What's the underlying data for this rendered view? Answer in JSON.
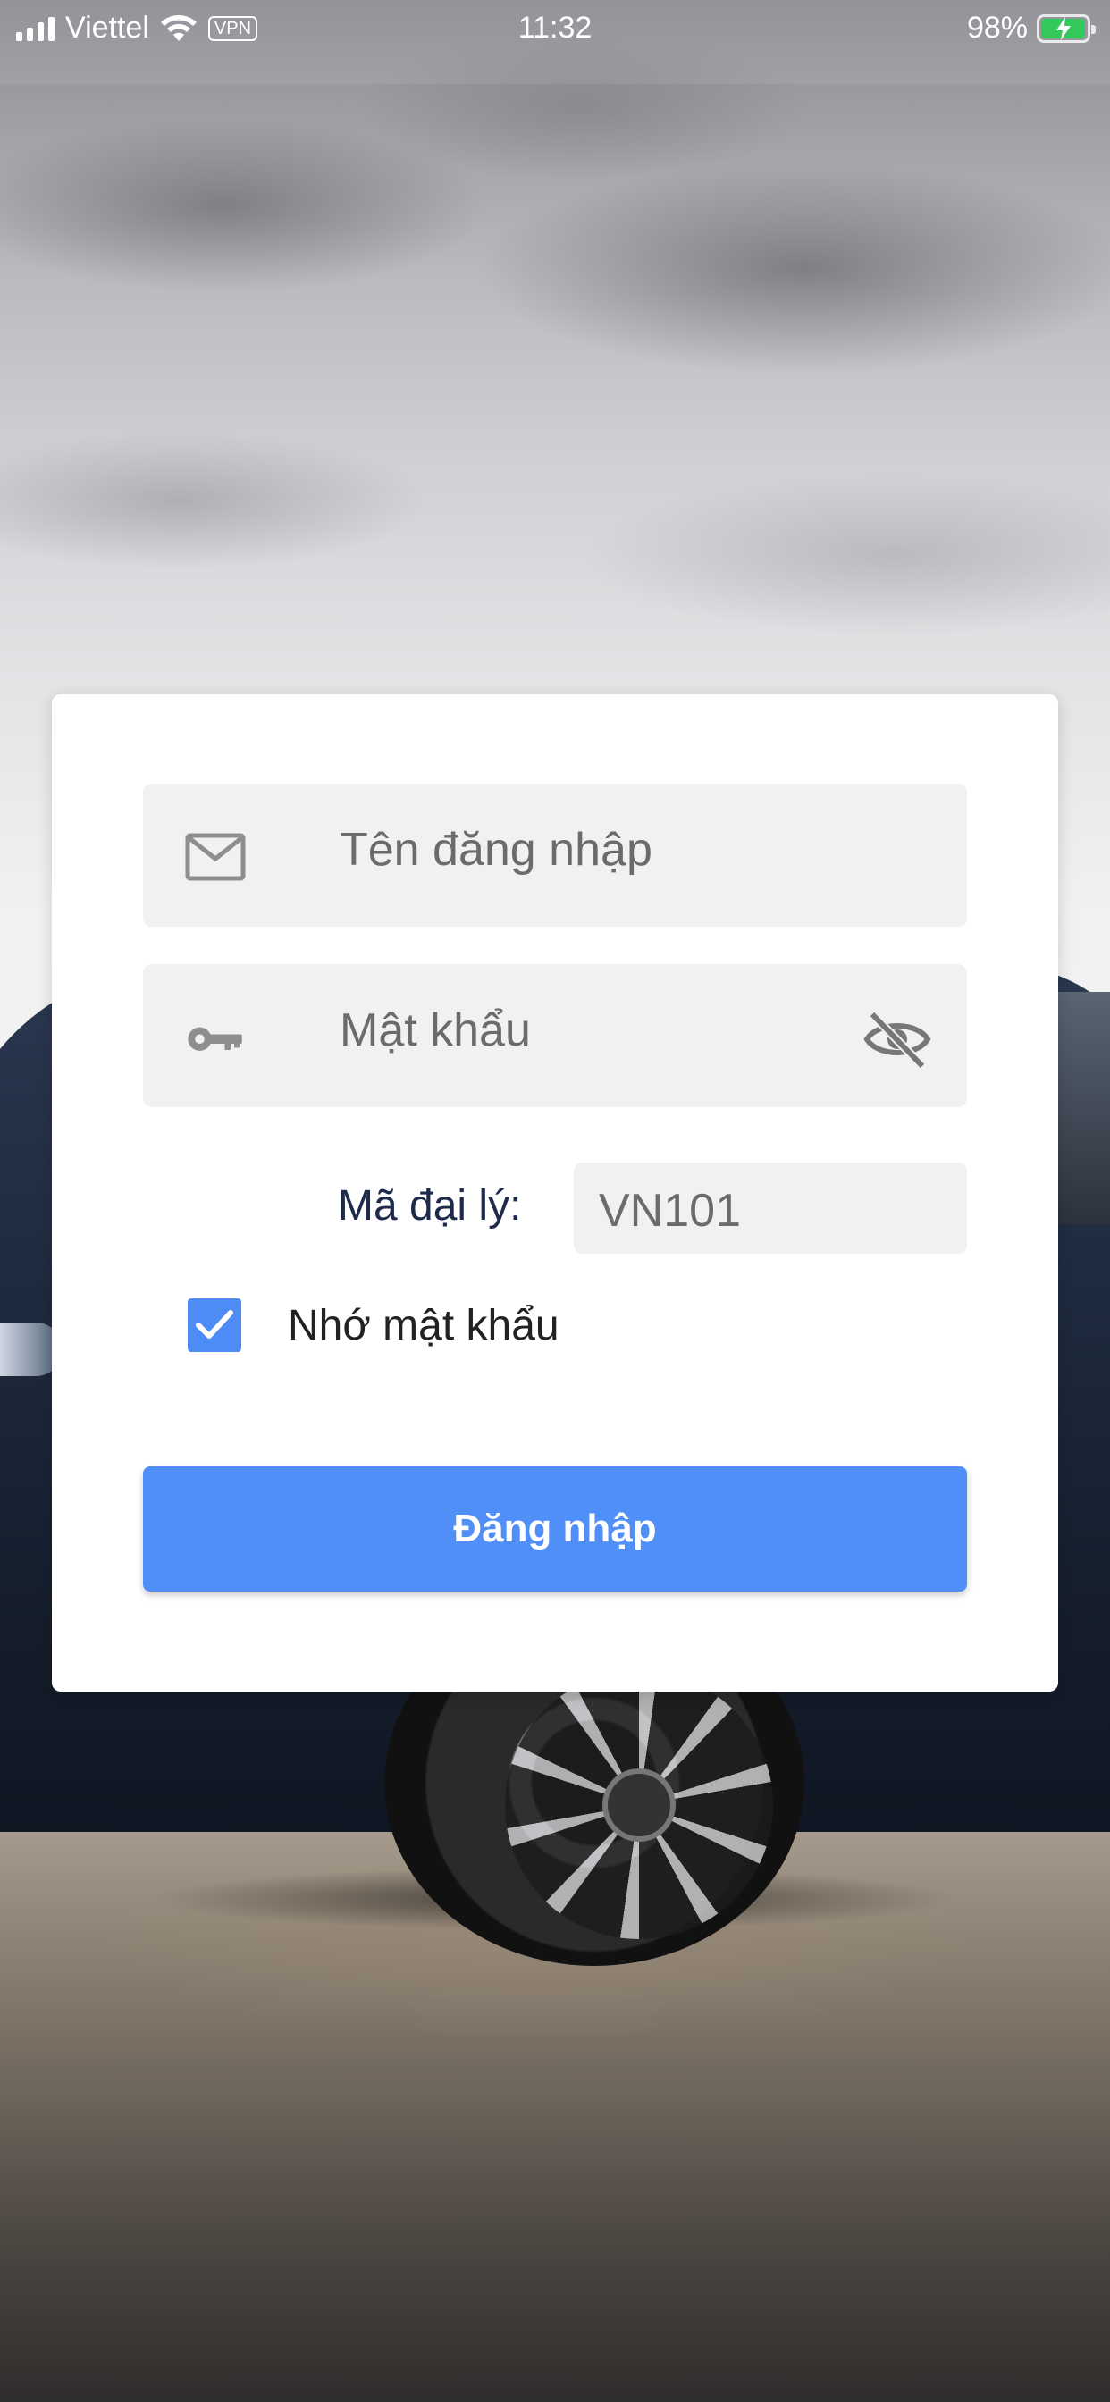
{
  "status_bar": {
    "carrier": "Viettel",
    "vpn": "VPN",
    "time": "11:32",
    "battery": "98%",
    "battery_level": 0.98
  },
  "login": {
    "username_placeholder": "Tên đăng nhập",
    "password_placeholder": "Mật khẩu",
    "agent_label": "Mã đại lý:",
    "agent_value": "VN101",
    "remember_label": "Nhớ mật khẩu",
    "remember_checked": true,
    "submit_label": "Đăng nhập"
  },
  "colors": {
    "primary": "#4f8ff7",
    "checkbox": "#4d8cf5",
    "field_bg": "#f1f1f1",
    "label": "#1e2a4a"
  },
  "icons": {
    "username": "mail-icon",
    "password": "key-icon",
    "toggle_password": "eye-off-icon",
    "checkbox": "checkmark-icon"
  }
}
